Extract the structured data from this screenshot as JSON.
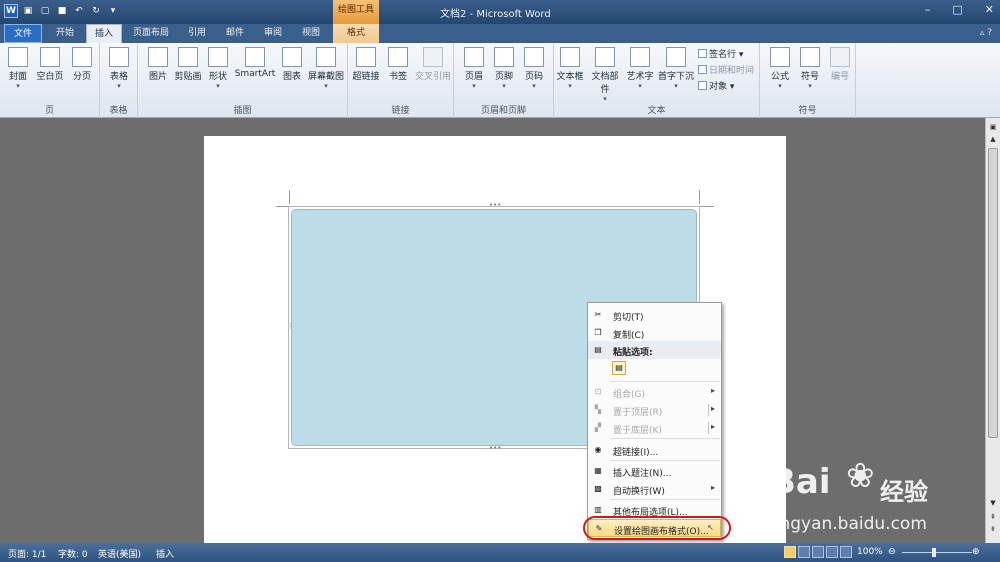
{
  "window": {
    "title": "文档2 - Microsoft Word",
    "contextual_group": "绘图工具",
    "controls": [
      "–",
      "□",
      "✕"
    ]
  },
  "qat": {
    "logo": "W"
  },
  "tabs": {
    "file": "文件",
    "home": "开始",
    "insert": "插入",
    "layout": "页面布局",
    "references": "引用",
    "mailings": "邮件",
    "review": "审阅",
    "view": "视图",
    "format": "格式"
  },
  "ribbon": {
    "pages": {
      "label": "页",
      "cover": "封面",
      "blank": "空白页",
      "break": "分页"
    },
    "tables": {
      "label": "表格",
      "table": "表格"
    },
    "illustrations": {
      "label": "插图",
      "picture": "图片",
      "clipart": "剪贴画",
      "shapes": "形状",
      "smartart": "SmartArt",
      "chart": "图表",
      "screenshot": "屏幕截图"
    },
    "links": {
      "label": "链接",
      "hyperlink": "超链接",
      "bookmark": "书签",
      "crossref": "交叉引用"
    },
    "header_footer": {
      "label": "页眉和页脚",
      "header": "页眉",
      "footer": "页脚",
      "page_number": "页码"
    },
    "text": {
      "label": "文本",
      "textbox": "文本框",
      "quickparts": "文档部件",
      "wordart": "艺术字",
      "dropcap": "首字下沉",
      "signature": "签名行",
      "datetime": "日期和时间",
      "object": "对象"
    },
    "symbols": {
      "label": "符号",
      "equation": "公式",
      "symbol": "符号",
      "number": "编号"
    }
  },
  "context_menu": {
    "cut": "剪切(T)",
    "copy": "复制(C)",
    "paste_options": "粘贴选项:",
    "group": "组合(G)",
    "bring_front": "置于顶层(R)",
    "send_back": "置于底层(K)",
    "hyperlink": "超链接(I)...",
    "insert_caption": "插入题注(N)...",
    "text_wrap": "自动换行(W)",
    "more_layout": "其他布局选项(L)...",
    "format_canvas": "设置绘图画布格式(O)..."
  },
  "status": {
    "page": "页面: 1/1",
    "words": "字数: 0",
    "language": "英语(美国)",
    "mode": "插入",
    "zoom": "100%"
  },
  "watermark": {
    "brand": "Bai",
    "brand_cn": "经验",
    "url": "jingyan.baidu.com"
  },
  "colors": {
    "canvas_fill": "#bcdde7",
    "title_bar": "#23476f",
    "highlight_border": "#d4161a"
  }
}
